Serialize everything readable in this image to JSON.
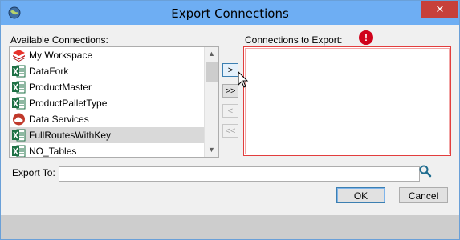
{
  "window": {
    "title": "Export Connections",
    "close_label": "✕"
  },
  "labels": {
    "available": "Available Connections:",
    "to_export": "Connections to Export:",
    "export_to": "Export To:"
  },
  "available_connections": [
    {
      "label": "My Workspace",
      "icon": "layers-icon",
      "selected": false
    },
    {
      "label": "DataFork",
      "icon": "excel-icon",
      "selected": false
    },
    {
      "label": "ProductMaster",
      "icon": "excel-icon",
      "selected": false
    },
    {
      "label": "ProductPalletType",
      "icon": "excel-icon",
      "selected": false
    },
    {
      "label": "Data Services",
      "icon": "cloud-icon",
      "selected": false
    },
    {
      "label": "FullRoutesWithKey",
      "icon": "excel-icon",
      "selected": true
    },
    {
      "label": "NO_Tables",
      "icon": "excel-icon",
      "selected": false
    }
  ],
  "move_buttons": {
    "add": ">",
    "add_all": ">>",
    "remove": "<",
    "remove_all": "<<"
  },
  "error_badge": "!",
  "export_to": {
    "value": ""
  },
  "buttons": {
    "ok": "OK",
    "cancel": "Cancel"
  },
  "colors": {
    "title_bar": "#6eaef3",
    "close": "#c7403a",
    "error": "#d0021b",
    "selection": "#d9d9d9"
  }
}
